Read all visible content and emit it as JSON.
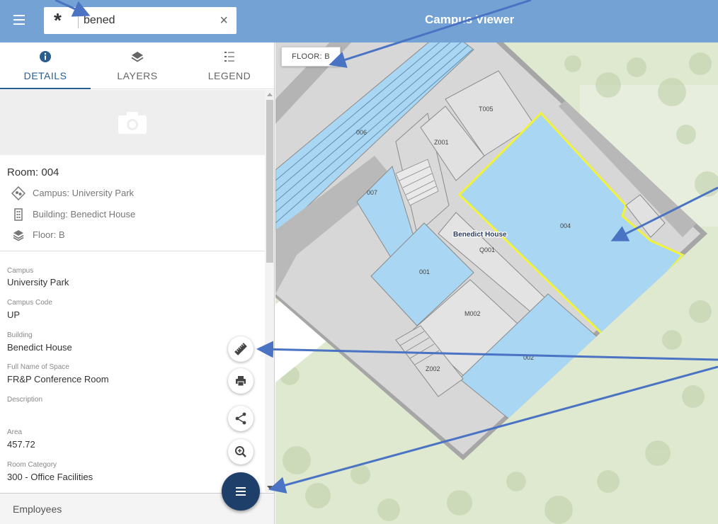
{
  "header": {
    "title": "Campus Viewer",
    "menu_icon": "hamburger-menu-icon"
  },
  "search": {
    "mode_icon": "asterisk-icon",
    "value": "bened",
    "clear_icon": "close-icon"
  },
  "tabs": [
    {
      "label": "DETAILS",
      "icon": "info-icon",
      "active": true
    },
    {
      "label": "LAYERS",
      "icon": "layers-icon",
      "active": false
    },
    {
      "label": "LEGEND",
      "icon": "list-icon",
      "active": false
    }
  ],
  "details": {
    "photo_icon": "camera-icon",
    "room_title": "Room: 004",
    "info": [
      {
        "icon": "campus-icon",
        "text": "Campus: University Park"
      },
      {
        "icon": "building-icon",
        "text": "Building: Benedict House"
      },
      {
        "icon": "layers-icon",
        "text": "Floor: B"
      }
    ],
    "attributes": [
      {
        "label": "Campus",
        "value": "University Park"
      },
      {
        "label": "Campus Code",
        "value": "UP"
      },
      {
        "label": "Building",
        "value": "Benedict House"
      },
      {
        "label": "Full Name of Space",
        "value": "FR&P Conference Room"
      },
      {
        "label": "Description",
        "value": ""
      },
      {
        "label": "Area",
        "value": "457.72"
      },
      {
        "label": "Room Category",
        "value": "300 - Office Facilities"
      }
    ],
    "employees_label": "Employees"
  },
  "tools": [
    {
      "name": "measure",
      "icon": "ruler-icon"
    },
    {
      "name": "print",
      "icon": "printer-icon"
    },
    {
      "name": "share",
      "icon": "share-icon"
    },
    {
      "name": "zoom",
      "icon": "zoom-in-icon"
    }
  ],
  "map": {
    "floor_label": "FLOOR: B",
    "building_label": "Benedict House",
    "rooms": [
      "006",
      "007",
      "Z001",
      "T005",
      "004",
      "001",
      "Q001",
      "M002",
      "Z002",
      "002"
    ],
    "colors": {
      "room_blue": "#a9d6f2",
      "room_grey": "#e3e3e3",
      "wall": "#a6a6a6",
      "selection": "#f2f23a",
      "grass": "#dfe9cf",
      "annotation_arrow": "#4a73c4"
    }
  }
}
